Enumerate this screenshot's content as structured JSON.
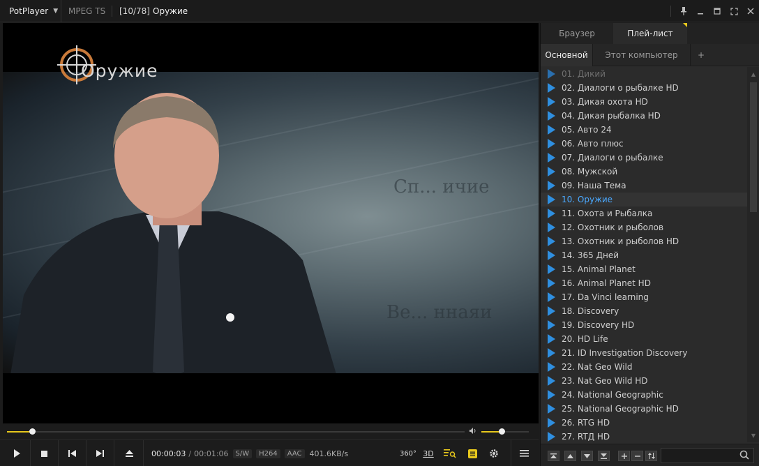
{
  "titlebar": {
    "app_name": "PotPlayer",
    "format": "MPEG TS",
    "counter": "[10/78]",
    "video_title": "Оружие"
  },
  "video": {
    "logo_text": "Оружие"
  },
  "seek": {
    "progress": 0.055,
    "volume": 0.42
  },
  "controls": {
    "time_current": "00:00:03",
    "time_separator": "/",
    "time_total": "00:01:06",
    "badge_sw": "S/W",
    "badge_codec": "H264",
    "badge_audio": "AAC",
    "bitrate": "401.6KB/s",
    "btn_360": "360°",
    "btn_3d": "3D"
  },
  "panel": {
    "tab_browser": "Браузер",
    "tab_playlist": "Плей-лист",
    "subtab_main": "Основной",
    "subtab_computer": "Этот компьютер",
    "subtab_add": "+",
    "playlist": [
      "01.  Дикий",
      "02.  Диалоги о рыбалке HD",
      "03.  Дикая охота HD",
      "04.  Дикая рыбалка HD",
      "05.  Авто 24",
      "06.  Авто плюс",
      "07.  Диалоги о рыбалке",
      "08.  Мужской",
      "09.  Наша Тема",
      "10.  Оружие",
      "11.  Охота и Рыбалка",
      "12.  Охотник и рыболов",
      "13.  Охотник и рыболов HD",
      "14.  365 Дней",
      "15.  Animal Planet",
      "16.  Animal Planet HD",
      "17.  Da Vinci learning",
      "18.  Discovery",
      "19.  Discovery HD",
      "20.  HD Life",
      "21.  ID Investigation Discovery",
      "22.  Nat Geo Wild",
      "23.  Nat Geo Wild HD",
      "24.  National Geographic",
      "25.  National Geographic HD",
      "26.  RTG HD",
      "27.  RTД HD"
    ],
    "current_index": 9,
    "dim_index": 0
  },
  "colors": {
    "accent": "#e8c81c",
    "play_icon": "#2f8fe0",
    "current_text": "#4aa8ff"
  }
}
